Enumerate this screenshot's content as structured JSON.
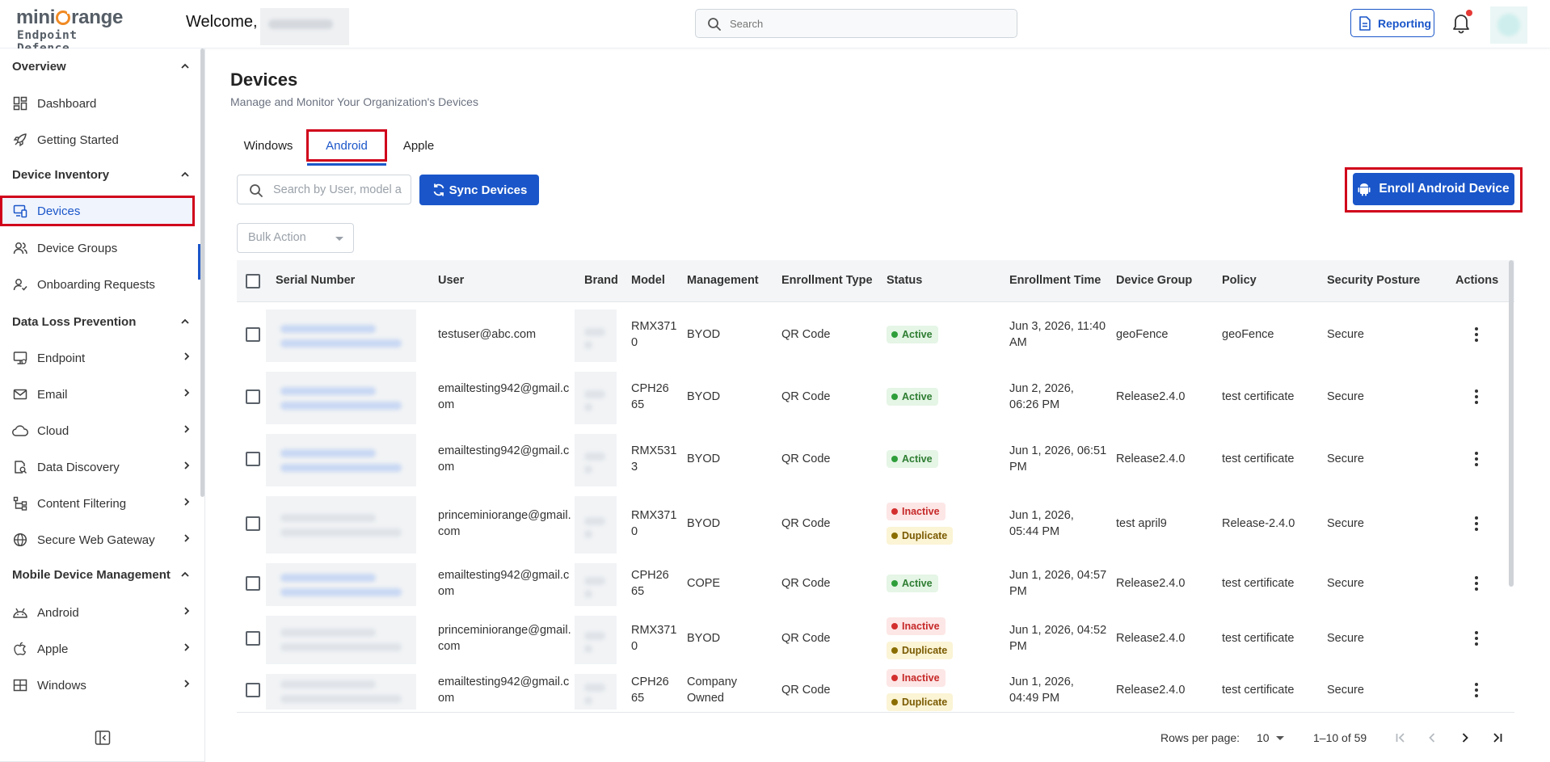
{
  "header": {
    "logo_brand_prefix": "mini",
    "logo_brand_suffix": "range",
    "logo_subtitle": "Endpoint Defence",
    "welcome_text": "Welcome,",
    "search_placeholder": "Search",
    "reporting_label": "Reporting"
  },
  "sidebar": {
    "sections": [
      {
        "label": "Overview"
      },
      {
        "label": "Device Inventory"
      },
      {
        "label": "Data Loss Prevention"
      },
      {
        "label": "Mobile Device Management"
      }
    ],
    "items": [
      {
        "label": "Dashboard",
        "icon": "dashboard-icon"
      },
      {
        "label": "Getting Started",
        "icon": "rocket-icon"
      },
      {
        "label": "Devices",
        "icon": "devices-icon"
      },
      {
        "label": "Device Groups",
        "icon": "users-icon"
      },
      {
        "label": "Onboarding Requests",
        "icon": "user-check-icon"
      },
      {
        "label": "Endpoint",
        "icon": "monitor-icon"
      },
      {
        "label": "Email",
        "icon": "mail-icon"
      },
      {
        "label": "Cloud",
        "icon": "cloud-icon"
      },
      {
        "label": "Data Discovery",
        "icon": "data-discovery-icon"
      },
      {
        "label": "Content Filtering",
        "icon": "content-filter-icon"
      },
      {
        "label": "Secure Web Gateway",
        "icon": "globe-icon"
      },
      {
        "label": "Android",
        "icon": "android-icon"
      },
      {
        "label": "Apple",
        "icon": "apple-icon"
      },
      {
        "label": "Windows",
        "icon": "windows-icon"
      }
    ]
  },
  "page": {
    "title": "Devices",
    "subtitle": "Manage and Monitor Your Organization's Devices",
    "tabs": [
      "Windows",
      "Android",
      "Apple"
    ],
    "active_tab": "Android",
    "device_search_placeholder": "Search by User, model a",
    "sync_label": "Sync Devices",
    "enroll_label": "Enroll Android Device",
    "bulk_action_placeholder": "Bulk Action"
  },
  "table": {
    "columns": [
      "Serial Number",
      "User",
      "Brand",
      "Model",
      "Management",
      "Enrollment Type",
      "Status",
      "Enrollment Time",
      "Device Group",
      "Policy",
      "Security Posture",
      "Actions"
    ],
    "rows": [
      {
        "user": [
          "testuser@abc.com"
        ],
        "model": [
          "RMX371",
          "0"
        ],
        "management": [
          "BYOD"
        ],
        "enrollment_type": "QR Code",
        "status": [
          "Active"
        ],
        "time": [
          "Jun 3, 2026, 11:40",
          "AM"
        ],
        "group": "geoFence",
        "policy": "geoFence",
        "posture": "Secure"
      },
      {
        "user": [
          "emailtesting942@gmail.c",
          "om"
        ],
        "model": [
          "CPH26",
          "65"
        ],
        "management": [
          "BYOD"
        ],
        "enrollment_type": "QR Code",
        "status": [
          "Active"
        ],
        "time": [
          "Jun 2, 2026,",
          "06:26 PM"
        ],
        "group": "Release2.4.0",
        "policy": "test certificate",
        "posture": "Secure"
      },
      {
        "user": [
          "emailtesting942@gmail.c",
          "om"
        ],
        "model": [
          "RMX531",
          "3"
        ],
        "management": [
          "BYOD"
        ],
        "enrollment_type": "QR Code",
        "status": [
          "Active"
        ],
        "time": [
          "Jun 1, 2026, 06:51",
          "PM"
        ],
        "group": "Release2.4.0",
        "policy": "test certificate",
        "posture": "Secure"
      },
      {
        "user": [
          "princeminiorange@gmail.",
          "com"
        ],
        "model": [
          "RMX371",
          "0"
        ],
        "management": [
          "BYOD"
        ],
        "enrollment_type": "QR Code",
        "status": [
          "Inactive",
          "Duplicate"
        ],
        "time": [
          "Jun 1, 2026,",
          "05:44 PM"
        ],
        "group": "test april9",
        "policy": "Release-2.4.0",
        "posture": "Secure"
      },
      {
        "user": [
          "emailtesting942@gmail.c",
          "om"
        ],
        "model": [
          "CPH26",
          "65"
        ],
        "management": [
          "COPE"
        ],
        "enrollment_type": "QR Code",
        "status": [
          "Active"
        ],
        "time": [
          "Jun 1, 2026, 04:57",
          "PM"
        ],
        "group": "Release2.4.0",
        "policy": "test certificate",
        "posture": "Secure"
      },
      {
        "user": [
          "princeminiorange@gmail.",
          "com"
        ],
        "model": [
          "RMX371",
          "0"
        ],
        "management": [
          "BYOD"
        ],
        "enrollment_type": "QR Code",
        "status": [
          "Inactive",
          "Duplicate"
        ],
        "time": [
          "Jun 1, 2026, 04:52",
          "PM"
        ],
        "group": "Release2.4.0",
        "policy": "test certificate",
        "posture": "Secure"
      },
      {
        "user": [
          "emailtesting942@gmail.c",
          "om"
        ],
        "model": [
          "CPH26",
          "65"
        ],
        "management": [
          "Company",
          "Owned"
        ],
        "enrollment_type": "QR Code",
        "status": [
          "Inactive",
          "Duplicate"
        ],
        "time": [
          "Jun 1, 2026,",
          "04:49 PM"
        ],
        "group": "Release2.4.0",
        "policy": "test certificate",
        "posture": "Secure"
      }
    ]
  },
  "pagination": {
    "rows_label": "Rows per page:",
    "rows_value": "10",
    "range": "1–10 of 59"
  },
  "colors": {
    "accent": "#1a56c9",
    "highlight_box": "#d0021b",
    "logo_orange": "#f08a24"
  }
}
